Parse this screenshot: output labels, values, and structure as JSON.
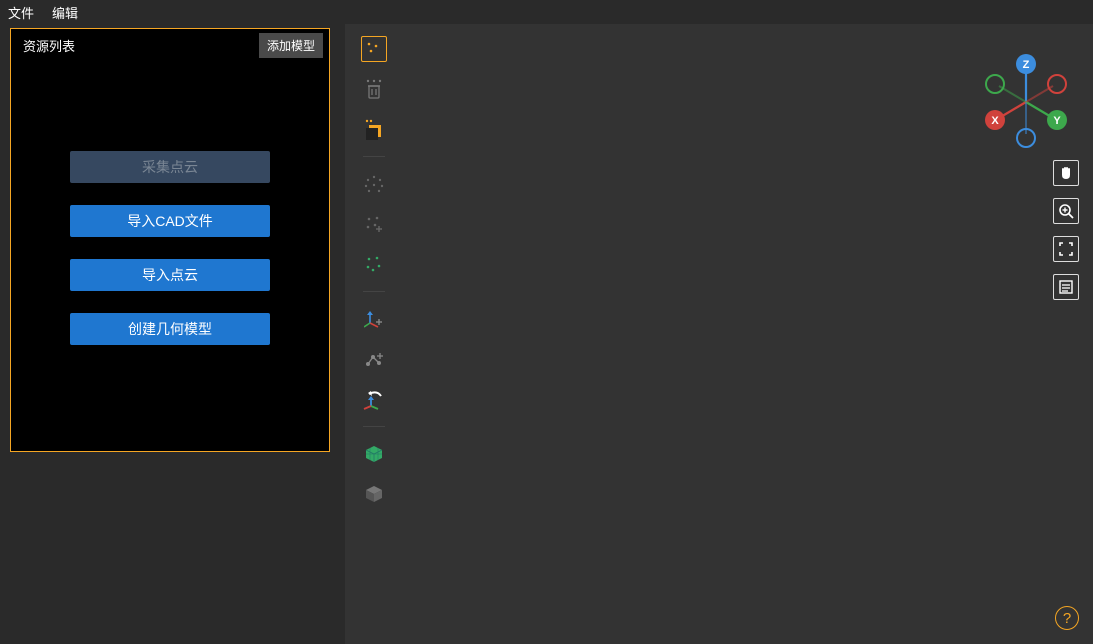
{
  "menubar": {
    "items": [
      "文件",
      "编辑"
    ]
  },
  "panel": {
    "title": "资源列表",
    "add_button": "添加模型",
    "buttons": {
      "collect": "采集点云",
      "import_cad": "导入CAD文件",
      "import_cloud": "导入点云",
      "create_geom": "创建几何模型"
    }
  },
  "toolbar_icons": [
    "select-points",
    "delete",
    "layer",
    "divider",
    "scatter-1",
    "scatter-2",
    "scatter-3",
    "divider",
    "axis-add",
    "measure",
    "rotate-axis",
    "divider",
    "cube-green",
    "cube-gray"
  ],
  "right_icons": [
    "pan-hand",
    "zoom-in",
    "fullscreen",
    "list"
  ],
  "axis_labels": {
    "x": "X",
    "y": "Y",
    "z": "Z"
  },
  "help": "?"
}
